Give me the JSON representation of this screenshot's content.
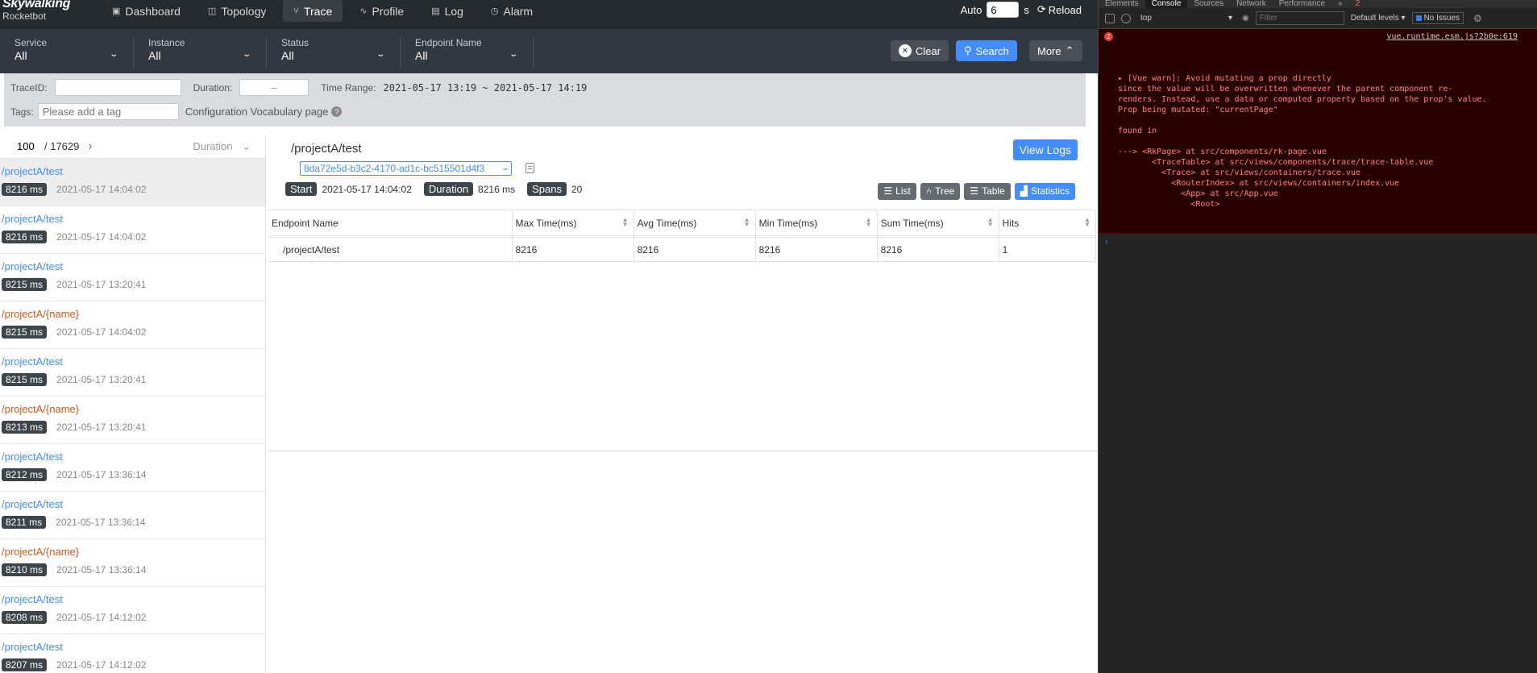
{
  "app": {
    "logo": {
      "line1": "Skywalking",
      "line2": "Rocketbot"
    },
    "nav": [
      {
        "label": "Dashboard",
        "icon": "dashboard-icon",
        "glyph": "▣"
      },
      {
        "label": "Topology",
        "icon": "topology-icon",
        "glyph": "◫"
      },
      {
        "label": "Trace",
        "icon": "trace-icon",
        "glyph": "⑂"
      },
      {
        "label": "Profile",
        "icon": "profile-icon",
        "glyph": "∿"
      },
      {
        "label": "Log",
        "icon": "log-icon",
        "glyph": "▤"
      },
      {
        "label": "Alarm",
        "icon": "alarm-icon",
        "glyph": "◷"
      }
    ],
    "auto_label": "Auto",
    "auto_value": "6",
    "auto_unit": "s",
    "reload_label": "Reload",
    "filters": [
      {
        "label": "Service",
        "value": "All"
      },
      {
        "label": "Instance",
        "value": "All"
      },
      {
        "label": "Status",
        "value": "All"
      },
      {
        "label": "Endpoint Name",
        "value": "All"
      }
    ],
    "clear_label": "Clear",
    "search_label": "Search",
    "more_label": "More",
    "traceid_label": "TraceID:",
    "traceid_value": "",
    "duration_label": "Duration:",
    "duration_value": "–",
    "timerange_label": "Time Range:",
    "timerange_value": "2021-05-17 13:19 ~ 2021-05-17 14:19",
    "tags_label": "Tags:",
    "tags_placeholder": "Please add a tag",
    "vocab_label": "Configuration Vocabulary page",
    "pager": {
      "page": "100",
      "total": "/ 17629",
      "sort": "Duration"
    },
    "traces": [
      {
        "endpoint": "/projectA/test",
        "duration": "8216 ms",
        "time": "2021-05-17 14:04:02",
        "named": false
      },
      {
        "endpoint": "/projectA/test",
        "duration": "8216 ms",
        "time": "2021-05-17 14:04:02",
        "named": false
      },
      {
        "endpoint": "/projectA/test",
        "duration": "8215 ms",
        "time": "2021-05-17 13:20:41",
        "named": false
      },
      {
        "endpoint": "/projectA/{name}",
        "duration": "8215 ms",
        "time": "2021-05-17 14:04:02",
        "named": true
      },
      {
        "endpoint": "/projectA/test",
        "duration": "8215 ms",
        "time": "2021-05-17 13:20:41",
        "named": false
      },
      {
        "endpoint": "/projectA/{name}",
        "duration": "8213 ms",
        "time": "2021-05-17 13:20:41",
        "named": true
      },
      {
        "endpoint": "/projectA/test",
        "duration": "8212 ms",
        "time": "2021-05-17 13:36:14",
        "named": false
      },
      {
        "endpoint": "/projectA/test",
        "duration": "8211 ms",
        "time": "2021-05-17 13:36:14",
        "named": false
      },
      {
        "endpoint": "/projectA/{name}",
        "duration": "8210 ms",
        "time": "2021-05-17 13:36:14",
        "named": true
      },
      {
        "endpoint": "/projectA/test",
        "duration": "8208 ms",
        "time": "2021-05-17 14:12:02",
        "named": false
      },
      {
        "endpoint": "/projectA/test",
        "duration": "8207 ms",
        "time": "2021-05-17 14:12:02",
        "named": false
      }
    ],
    "detail": {
      "title": "/projectA/test",
      "trace_id": "8da72e5d-b3c2-4170-ad1c-bc515501d4f3",
      "start_label": "Start",
      "start_value": "2021-05-17 14:04:02",
      "duration_label": "Duration",
      "duration_value": "8216 ms",
      "spans_label": "Spans",
      "spans_value": "20",
      "view_logs_label": "View Logs",
      "tabs": [
        {
          "label": "List",
          "icon": "list-icon",
          "glyph": "☰",
          "active": false
        },
        {
          "label": "Tree",
          "icon": "tree-icon",
          "glyph": "⑃",
          "active": false
        },
        {
          "label": "Table",
          "icon": "table-icon",
          "glyph": "☰",
          "active": false
        },
        {
          "label": "Statistics",
          "icon": "statistics-icon",
          "glyph": "▟",
          "active": true
        }
      ],
      "columns": [
        "Endpoint Name",
        "Max Time(ms)",
        "Avg Time(ms)",
        "Min Time(ms)",
        "Sum Time(ms)",
        "Hits"
      ],
      "rows": [
        [
          "/projectA/test",
          "8216",
          "8216",
          "8216",
          "8216",
          "1"
        ]
      ]
    }
  },
  "devtools": {
    "tabs": [
      "Elements",
      "Console",
      "Sources",
      "Network",
      "Performance"
    ],
    "more_tabs": "»",
    "error_count": "2",
    "context": "top",
    "filter_placeholder": "Filter",
    "levels": "Default levels",
    "issues": "No Issues",
    "error_source": "vue.runtime.esm.js?2b0e:619",
    "error_count_badge": "2",
    "error_lines": [
      "▸ [Vue warn]: Avoid mutating a prop directly",
      "since the value will be overwritten whenever the parent component re-",
      "renders. Instead, use a data or computed property based on the prop's value.",
      "Prop being mutated: \"currentPage\"",
      "",
      "found in",
      "",
      "---> <RkPage> at src/components/rk-page.vue",
      "       <TraceTable> at src/views/components/trace/trace-table.vue",
      "         <Trace> at src/views/containers/trace.vue",
      "           <RouterIndex> at src/views/containers/index.vue",
      "             <App> at src/App.vue",
      "               <Root>"
    ],
    "prompt": "›"
  }
}
